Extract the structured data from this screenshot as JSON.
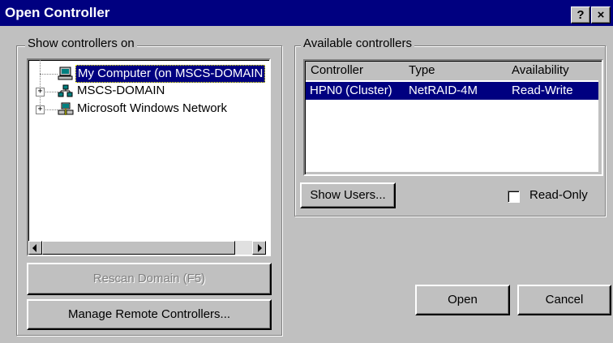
{
  "window": {
    "title": "Open Controller",
    "help_label": "?",
    "close_label": "×"
  },
  "left_group": {
    "label": "Show controllers on",
    "tree": [
      {
        "label": "My Computer (on MSCS-DOMAIN",
        "selected": true,
        "expandable": false,
        "icon": "computer-icon"
      },
      {
        "label": "MSCS-DOMAIN",
        "selected": false,
        "expandable": true,
        "icon": "domain-icon"
      },
      {
        "label": "Microsoft Windows Network",
        "selected": false,
        "expandable": true,
        "icon": "network-icon"
      }
    ]
  },
  "buttons": {
    "rescan": "Rescan Domain (F5)",
    "manage": "Manage Remote Controllers...",
    "show_users": "Show Users...",
    "open": "Open",
    "cancel": "Cancel"
  },
  "right_group": {
    "label": "Available controllers",
    "columns": [
      "Controller",
      "Type",
      "Availability"
    ],
    "rows": [
      {
        "controller": "HPN0 (Cluster)",
        "type": "NetRAID-4M",
        "availability": "Read-Write",
        "selected": true
      }
    ]
  },
  "read_only": {
    "label": "Read-Only",
    "checked": false
  },
  "colors": {
    "titlebar": "#000080",
    "selection": "#000080",
    "face": "#c0c0c0"
  }
}
